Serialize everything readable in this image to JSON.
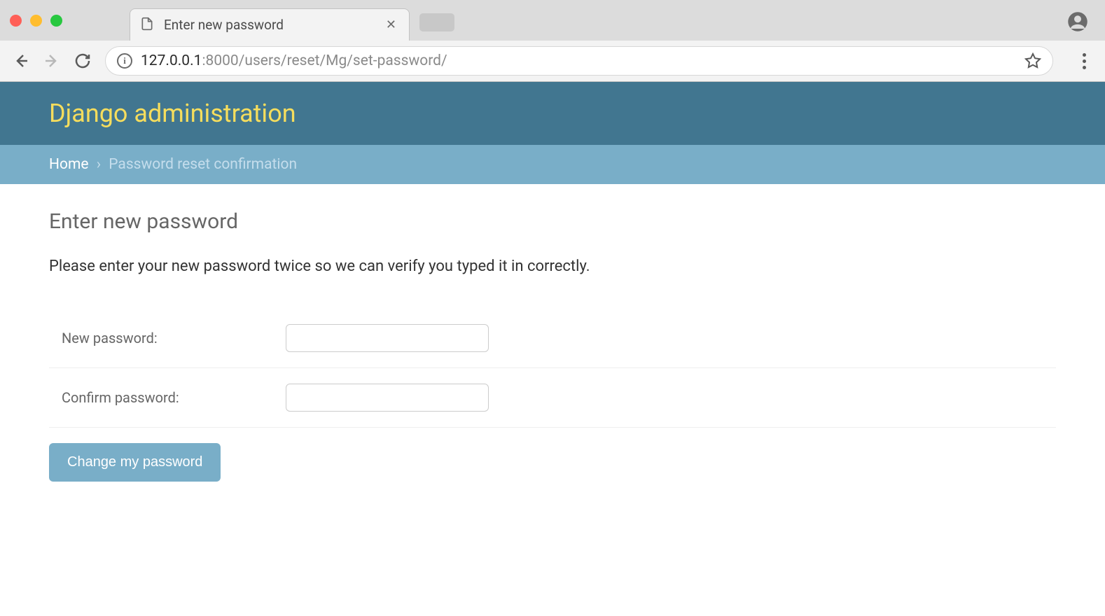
{
  "browser": {
    "tab_title": "Enter new password",
    "url_host": "127.0.0.1",
    "url_port_path": ":8000/users/reset/Mg/set-password/",
    "info_glyph": "i"
  },
  "header": {
    "title": "Django administration"
  },
  "breadcrumb": {
    "home": "Home",
    "separator": "›",
    "current": "Password reset confirmation"
  },
  "page": {
    "heading": "Enter new password",
    "instruction": "Please enter your new password twice so we can verify you typed it in correctly.",
    "new_password_label": "New password:",
    "confirm_password_label": "Confirm password:",
    "submit_label": "Change my password"
  }
}
